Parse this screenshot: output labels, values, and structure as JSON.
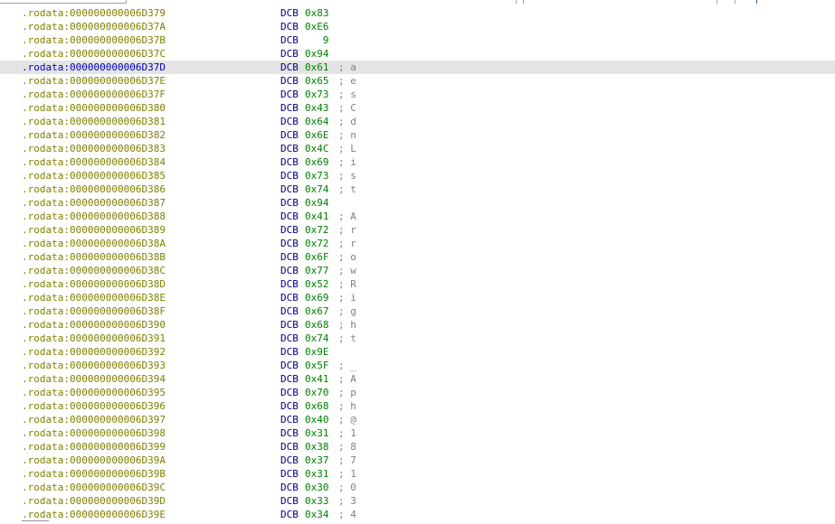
{
  "listing": {
    "selected_index": 4,
    "rows": [
      {
        "address": ".rodata:000000000006D379",
        "mnemonic": "DCB",
        "operand": "0x83",
        "comment": ""
      },
      {
        "address": ".rodata:000000000006D37A",
        "mnemonic": "DCB",
        "operand": "0xE6",
        "comment": ""
      },
      {
        "address": ".rodata:000000000006D37B",
        "mnemonic": "DCB",
        "operand": "   9",
        "comment": ""
      },
      {
        "address": ".rodata:000000000006D37C",
        "mnemonic": "DCB",
        "operand": "0x94",
        "comment": ""
      },
      {
        "address": ".rodata:000000000006D37D",
        "mnemonic": "DCB",
        "operand": "0x61",
        "comment": "; a"
      },
      {
        "address": ".rodata:000000000006D37E",
        "mnemonic": "DCB",
        "operand": "0x65",
        "comment": "; e"
      },
      {
        "address": ".rodata:000000000006D37F",
        "mnemonic": "DCB",
        "operand": "0x73",
        "comment": "; s"
      },
      {
        "address": ".rodata:000000000006D380",
        "mnemonic": "DCB",
        "operand": "0x43",
        "comment": "; C"
      },
      {
        "address": ".rodata:000000000006D381",
        "mnemonic": "DCB",
        "operand": "0x64",
        "comment": "; d"
      },
      {
        "address": ".rodata:000000000006D382",
        "mnemonic": "DCB",
        "operand": "0x6E",
        "comment": "; n"
      },
      {
        "address": ".rodata:000000000006D383",
        "mnemonic": "DCB",
        "operand": "0x4C",
        "comment": "; L"
      },
      {
        "address": ".rodata:000000000006D384",
        "mnemonic": "DCB",
        "operand": "0x69",
        "comment": "; i"
      },
      {
        "address": ".rodata:000000000006D385",
        "mnemonic": "DCB",
        "operand": "0x73",
        "comment": "; s"
      },
      {
        "address": ".rodata:000000000006D386",
        "mnemonic": "DCB",
        "operand": "0x74",
        "comment": "; t"
      },
      {
        "address": ".rodata:000000000006D387",
        "mnemonic": "DCB",
        "operand": "0x94",
        "comment": ""
      },
      {
        "address": ".rodata:000000000006D388",
        "mnemonic": "DCB",
        "operand": "0x41",
        "comment": "; A"
      },
      {
        "address": ".rodata:000000000006D389",
        "mnemonic": "DCB",
        "operand": "0x72",
        "comment": "; r"
      },
      {
        "address": ".rodata:000000000006D38A",
        "mnemonic": "DCB",
        "operand": "0x72",
        "comment": "; r"
      },
      {
        "address": ".rodata:000000000006D38B",
        "mnemonic": "DCB",
        "operand": "0x6F",
        "comment": "; o"
      },
      {
        "address": ".rodata:000000000006D38C",
        "mnemonic": "DCB",
        "operand": "0x77",
        "comment": "; w"
      },
      {
        "address": ".rodata:000000000006D38D",
        "mnemonic": "DCB",
        "operand": "0x52",
        "comment": "; R"
      },
      {
        "address": ".rodata:000000000006D38E",
        "mnemonic": "DCB",
        "operand": "0x69",
        "comment": "; i"
      },
      {
        "address": ".rodata:000000000006D38F",
        "mnemonic": "DCB",
        "operand": "0x67",
        "comment": "; g"
      },
      {
        "address": ".rodata:000000000006D390",
        "mnemonic": "DCB",
        "operand": "0x68",
        "comment": "; h"
      },
      {
        "address": ".rodata:000000000006D391",
        "mnemonic": "DCB",
        "operand": "0x74",
        "comment": "; t"
      },
      {
        "address": ".rodata:000000000006D392",
        "mnemonic": "DCB",
        "operand": "0x9E",
        "comment": ""
      },
      {
        "address": ".rodata:000000000006D393",
        "mnemonic": "DCB",
        "operand": "0x5F",
        "comment": "; _"
      },
      {
        "address": ".rodata:000000000006D394",
        "mnemonic": "DCB",
        "operand": "0x41",
        "comment": "; A"
      },
      {
        "address": ".rodata:000000000006D395",
        "mnemonic": "DCB",
        "operand": "0x70",
        "comment": "; p"
      },
      {
        "address": ".rodata:000000000006D396",
        "mnemonic": "DCB",
        "operand": "0x68",
        "comment": "; h"
      },
      {
        "address": ".rodata:000000000006D397",
        "mnemonic": "DCB",
        "operand": "0x40",
        "comment": "; @"
      },
      {
        "address": ".rodata:000000000006D398",
        "mnemonic": "DCB",
        "operand": "0x31",
        "comment": "; 1"
      },
      {
        "address": ".rodata:000000000006D399",
        "mnemonic": "DCB",
        "operand": "0x38",
        "comment": "; 8"
      },
      {
        "address": ".rodata:000000000006D39A",
        "mnemonic": "DCB",
        "operand": "0x37",
        "comment": "; 7"
      },
      {
        "address": ".rodata:000000000006D39B",
        "mnemonic": "DCB",
        "operand": "0x31",
        "comment": "; 1"
      },
      {
        "address": ".rodata:000000000006D39C",
        "mnemonic": "DCB",
        "operand": "0x30",
        "comment": "; 0"
      },
      {
        "address": ".rodata:000000000006D39D",
        "mnemonic": "DCB",
        "operand": "0x33",
        "comment": "; 3"
      },
      {
        "address": ".rodata:000000000006D39E",
        "mnemonic": "DCB",
        "operand": "0x34",
        "comment": "; 4"
      }
    ]
  },
  "colors": {
    "address": "#808000",
    "address_selected": "#0000c0",
    "mnemonic": "#000080",
    "operand": "#008000",
    "comment": "#808080",
    "selected_row_bg": "#e4e4e4"
  }
}
